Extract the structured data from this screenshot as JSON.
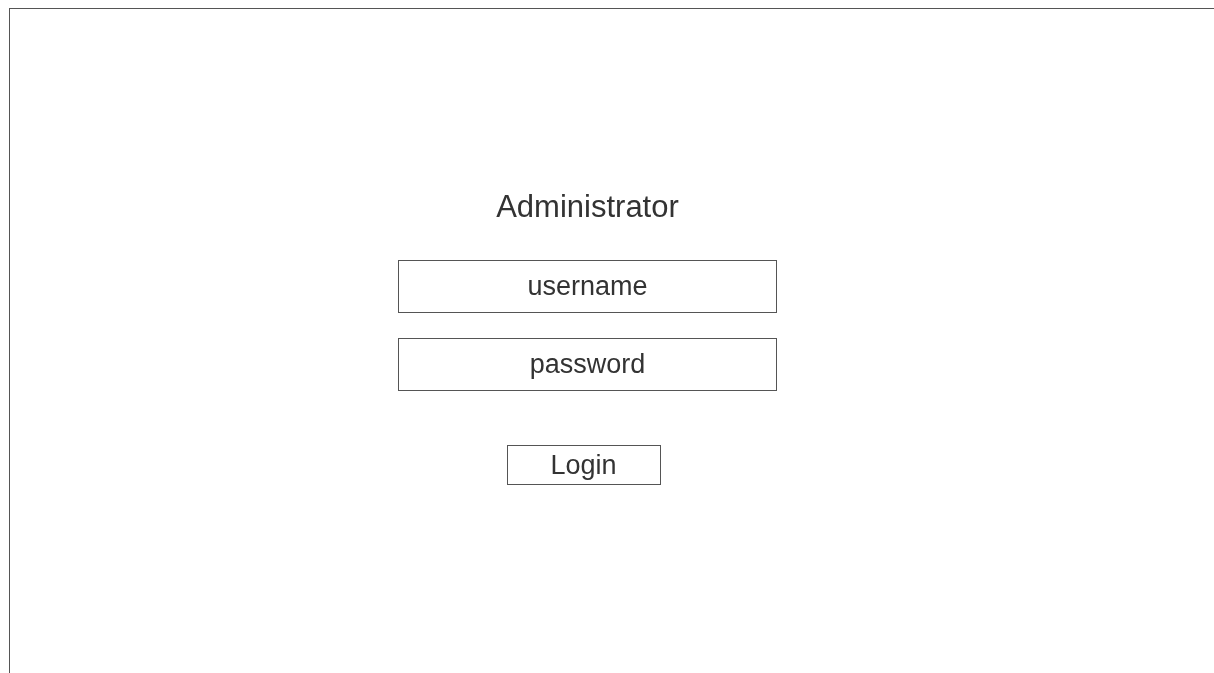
{
  "title": "Administrator",
  "fields": [
    {
      "placeholder": "username"
    },
    {
      "placeholder": "password"
    }
  ],
  "button": "Login"
}
